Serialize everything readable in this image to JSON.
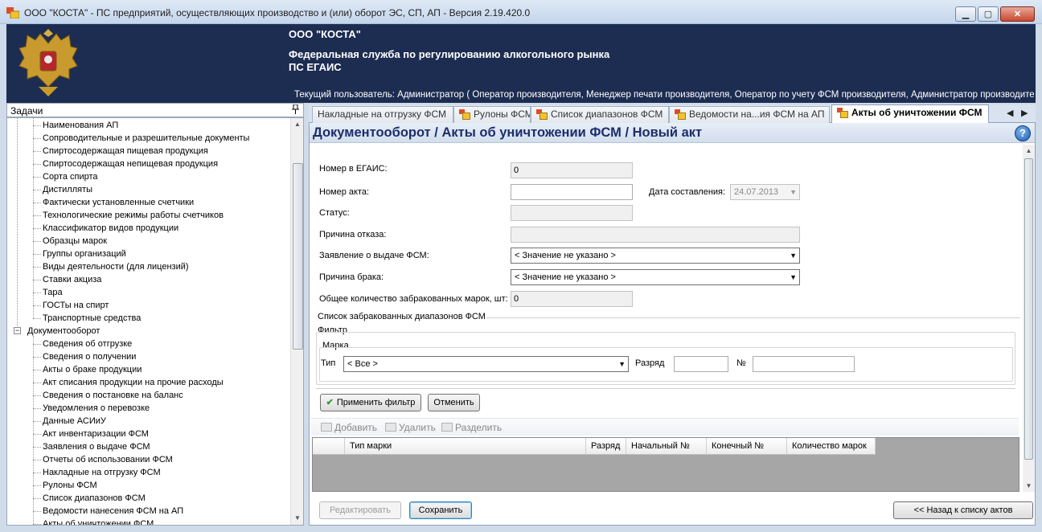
{
  "window": {
    "title": "ООО \"КОСТА\" - ПС предприятий, осуществляющих производство и (или) оборот ЭС, СП, АП - Версия 2.19.420.0",
    "controls": {
      "minimize": "▁",
      "maximize": "▢",
      "close": "✕"
    }
  },
  "banner": {
    "org": "ООО \"КОСТА\"",
    "service_line1": "Федеральная служба по регулированию алкогольного рынка",
    "service_line2": "ПС ЕГАИС",
    "current_user": "Текущий пользователь: Администратор ( Оператор производителя, Менеджер печати производителя, Оператор по учету ФСМ производителя, Администратор производителя, О..."
  },
  "left_panel": {
    "title": "Задачи",
    "pin": "ᵖ",
    "tree_children_top": [
      "Наименования АП",
      "Сопроводительные и разрешительные документы",
      "Спиртосодержащая пищевая продукция",
      "Спиртосодержащая непищевая продукция",
      "Сорта спирта",
      "Дистилляты",
      "Фактически установленные счетчики",
      "Технологические режимы работы счетчиков",
      "Классификатор видов продукции",
      "Образцы марок",
      "Группы организаций",
      "Виды деятельности (для лицензий)",
      "Ставки акциза",
      "Тара",
      "ГОСТы на спирт",
      "Транспортные средства"
    ],
    "tree_parent": "Документооборот",
    "tree_children_bottom": [
      "Сведения об отгрузке",
      "Сведения о получении",
      "Акты о браке продукции",
      "Акт списания продукции на прочие расходы",
      "Сведения о постановке на баланс",
      "Уведомления о перевозке",
      "Данные АСИиУ",
      "Акт инвентаризации ФСМ",
      "Заявления о выдаче ФСМ",
      "Отчеты об использовании ФСМ",
      "Накладные на отгрузку ФСМ",
      "Рулоны ФСМ",
      "Список диапазонов ФСМ",
      "Ведомости нанесения ФСМ на АП",
      "Акты об уничтожении ФСМ"
    ]
  },
  "tabs": [
    {
      "label": "Накладные на отгрузку ФСМ"
    },
    {
      "label": "Рулоны ФСМ"
    },
    {
      "label": "Список диапазонов ФСМ"
    },
    {
      "label": "Ведомости на...ия ФСМ на АП"
    },
    {
      "label": "Акты об уничтожении ФСМ"
    }
  ],
  "tab_nav": {
    "prev": "◀",
    "next": "▶"
  },
  "doc": {
    "title": "Документооборот / Акты об уничтожении ФСМ / Новый акт",
    "help": "?"
  },
  "form": {
    "egais_number_label": "Номер в ЕГАИС:",
    "egais_number_value": "0",
    "act_number_label": "Номер акта:",
    "act_number_value": "",
    "date_label": "Дата составления:",
    "date_value": "24.07.2013",
    "status_label": "Статус:",
    "status_value": "",
    "reject_reason_label": "Причина отказа:",
    "reject_reason_value": "",
    "fsm_application_label": "Заявление о выдаче ФСМ:",
    "fsm_application_value": "< Значение не указано >",
    "defect_reason_label": "Причина брака:",
    "defect_reason_value": "< Значение не указано >",
    "total_rejected_label": "Общее количество забракованных марок, шт:",
    "total_rejected_value": "0"
  },
  "ranges_section": {
    "title": "Список забракованных диапазонов ФСМ",
    "filter_title": "Фильтр",
    "mark_title": "Марка",
    "type_label": "Тип",
    "type_value": "< Все >",
    "rank_label": "Разряд",
    "rank_value": "",
    "number_label": "№",
    "number_value": "",
    "apply_filter": "Применить фильтр",
    "cancel": "Отменить"
  },
  "toolbar": {
    "add": "Добавить",
    "delete": "Удалить",
    "split": "Разделить"
  },
  "grid": {
    "columns": [
      "Тип марки",
      "Разряд",
      "Начальный №",
      "Конечный №",
      "Количество марок"
    ]
  },
  "footer": {
    "edit": "Редактировать",
    "save": "Сохранить",
    "back": "<< Назад к списку актов"
  },
  "colors": {
    "banner_bg": "#1d2d51",
    "title_color": "#1d2d6b"
  }
}
